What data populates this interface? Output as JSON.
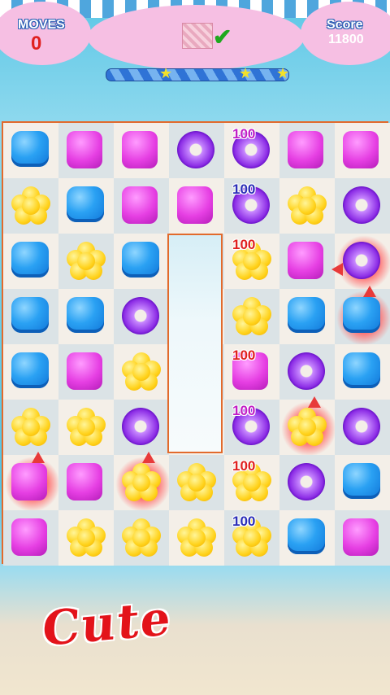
{
  "hud": {
    "moves_label": "MOVES",
    "moves_value": "0",
    "score_label": "Score",
    "score_value": "11800",
    "goal_done_icon": "checkmark-icon",
    "progress_stars": [
      "star-icon",
      "star-icon",
      "star-icon"
    ]
  },
  "board": {
    "rows": [
      [
        "cube",
        "mallow",
        "mallow",
        "donut",
        "donut",
        "mallow",
        "mallow"
      ],
      [
        "flower",
        "cube",
        "mallow",
        "mallow",
        "donut",
        "flower",
        "donut"
      ],
      [
        "cube",
        "flower",
        "cube",
        "window",
        "flower",
        "mallow",
        "donut"
      ],
      [
        "cube",
        "cube",
        "donut",
        "window",
        "flower",
        "cube",
        "cube"
      ],
      [
        "cube",
        "mallow",
        "flower",
        "window",
        "mallow",
        "donut",
        "cube"
      ],
      [
        "flower",
        "flower",
        "donut",
        "window",
        "donut",
        "flower",
        "donut"
      ],
      [
        "mallow",
        "mallow",
        "flower",
        "flower",
        "flower",
        "donut",
        "cube"
      ],
      [
        "mallow",
        "flower",
        "flower",
        "flower",
        "flower",
        "cube",
        "mallow"
      ]
    ],
    "points": [
      {
        "row": 0,
        "col": 4,
        "text": "100",
        "color": "#c21ec5"
      },
      {
        "row": 1,
        "col": 4,
        "text": "100",
        "color": "#2b2fb7"
      },
      {
        "row": 2,
        "col": 4,
        "text": "100",
        "color": "#e0201f"
      },
      {
        "row": 4,
        "col": 4,
        "text": "100",
        "color": "#e0201f"
      },
      {
        "row": 5,
        "col": 4,
        "text": "100",
        "color": "#c21ec5"
      },
      {
        "row": 6,
        "col": 4,
        "text": "100",
        "color": "#e0201f"
      },
      {
        "row": 7,
        "col": 4,
        "text": "100",
        "color": "#2b2fb7"
      }
    ],
    "striped": [
      {
        "row": 2,
        "col": 6,
        "dir": "h"
      },
      {
        "row": 3,
        "col": 6,
        "dir": "v"
      },
      {
        "row": 5,
        "col": 5,
        "dir": "v"
      },
      {
        "row": 6,
        "col": 0,
        "dir": "v"
      },
      {
        "row": 6,
        "col": 2,
        "dir": "v"
      }
    ]
  },
  "banner": {
    "text": "Cute"
  },
  "colors": {
    "board_border": "#e26a2c",
    "moves_value": "#e0201f",
    "cloud": "#f6bfe3"
  }
}
